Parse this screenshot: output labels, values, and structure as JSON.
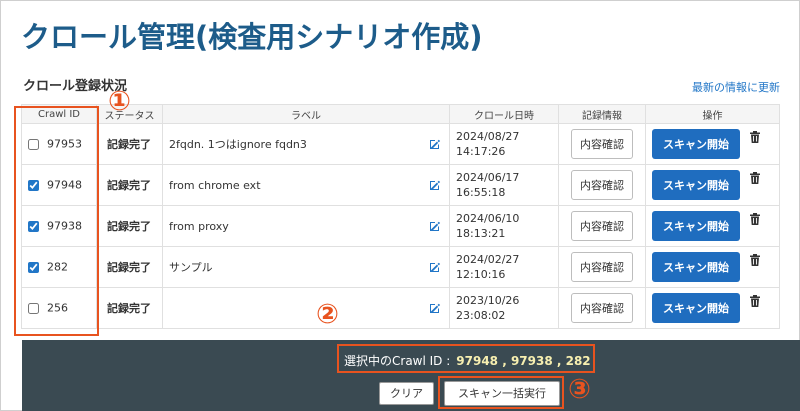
{
  "page": {
    "title": "クロール管理(検査用シナリオ作成)",
    "section_title": "クロール登録状況",
    "refresh_link": "最新の情報に更新"
  },
  "table": {
    "headers": [
      "Crawl ID",
      "ステータス",
      "ラベル",
      "クロール日時",
      "記録情報",
      "操作"
    ],
    "rows": [
      {
        "id": "97953",
        "checked": false,
        "status": "記録完了",
        "label": "2fqdn. 1つはignore fqdn3",
        "date": "2024/08/27",
        "time": "14:17:26",
        "detail": "内容確認",
        "scan": "スキャン開始"
      },
      {
        "id": "97948",
        "checked": true,
        "status": "記録完了",
        "label": "from chrome ext",
        "date": "2024/06/17",
        "time": "16:55:18",
        "detail": "内容確認",
        "scan": "スキャン開始"
      },
      {
        "id": "97938",
        "checked": true,
        "status": "記録完了",
        "label": "from proxy",
        "date": "2024/06/10",
        "time": "18:13:21",
        "detail": "内容確認",
        "scan": "スキャン開始"
      },
      {
        "id": "282",
        "checked": true,
        "status": "記録完了",
        "label": "サンプル",
        "date": "2024/02/27",
        "time": "12:10:16",
        "detail": "内容確認",
        "scan": "スキャン開始"
      },
      {
        "id": "256",
        "checked": false,
        "status": "記録完了",
        "label": "",
        "date": "2023/10/26",
        "time": "23:08:02",
        "detail": "内容確認",
        "scan": "スキャン開始"
      }
    ]
  },
  "bottom_bar": {
    "selected_label": "選択中のCrawl ID :",
    "selected_ids": "97948 , 97938 , 282",
    "clear_button": "クリア",
    "bulk_button": "スキャン一括実行"
  },
  "annotations": {
    "marker_1": "①",
    "marker_2": "②",
    "marker_3": "③",
    "highlight_color": "#e8531f"
  },
  "colors": {
    "title": "#1d5c8a",
    "status_green": "#2e9a2e",
    "scan_button": "#1f6dbf",
    "bottom_bar": "#3a4a52"
  }
}
